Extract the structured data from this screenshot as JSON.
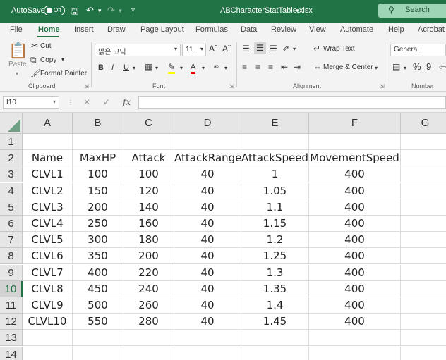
{
  "titlebar": {
    "autosave_label": "AutoSave",
    "autosave_state": "Off",
    "filename": "ABCharacterStatTable.xlsx",
    "search_placeholder": "Search",
    "accent_color": "#217346"
  },
  "tabs": [
    "File",
    "Home",
    "Insert",
    "Draw",
    "Page Layout",
    "Formulas",
    "Data",
    "Review",
    "View",
    "Automate",
    "Help",
    "Acrobat"
  ],
  "active_tab": "Home",
  "ribbon": {
    "clipboard": {
      "paste": "Paste",
      "cut": "Cut",
      "copy": "Copy",
      "format_painter": "Format Painter",
      "label": "Clipboard"
    },
    "font": {
      "name": "맑은 고딕",
      "size": "11",
      "label": "Font"
    },
    "alignment": {
      "wrap_text": "Wrap Text",
      "merge_center": "Merge & Center",
      "label": "Alignment"
    },
    "number": {
      "format": "General",
      "label": "Number"
    }
  },
  "formula_bar": {
    "name_box": "I10",
    "fx": "fx",
    "content": ""
  },
  "grid": {
    "columns": [
      "A",
      "B",
      "C",
      "D",
      "E",
      "F",
      "G"
    ],
    "row_numbers": [
      "1",
      "2",
      "3",
      "4",
      "5",
      "6",
      "7",
      "8",
      "9",
      "10",
      "11",
      "12",
      "13",
      "14"
    ],
    "active_row": "10",
    "rows": [
      [
        "",
        "",
        "",
        "",
        "",
        "",
        ""
      ],
      [
        "Name",
        "MaxHP",
        "Attack",
        "AttackRange",
        "AttackSpeed",
        "MovementSpeed",
        ""
      ],
      [
        "CLVL1",
        "100",
        "100",
        "40",
        "1",
        "400",
        ""
      ],
      [
        "CLVL2",
        "150",
        "120",
        "40",
        "1.05",
        "400",
        ""
      ],
      [
        "CLVL3",
        "200",
        "140",
        "40",
        "1.1",
        "400",
        ""
      ],
      [
        "CLVL4",
        "250",
        "160",
        "40",
        "1.15",
        "400",
        ""
      ],
      [
        "CLVL5",
        "300",
        "180",
        "40",
        "1.2",
        "400",
        ""
      ],
      [
        "CLVL6",
        "350",
        "200",
        "40",
        "1.25",
        "400",
        ""
      ],
      [
        "CLVL7",
        "400",
        "220",
        "40",
        "1.3",
        "400",
        ""
      ],
      [
        "CLVL8",
        "450",
        "240",
        "40",
        "1.35",
        "400",
        ""
      ],
      [
        "CLVL9",
        "500",
        "260",
        "40",
        "1.4",
        "400",
        ""
      ],
      [
        "CLVL10",
        "550",
        "280",
        "40",
        "1.45",
        "400",
        ""
      ],
      [
        "",
        "",
        "",
        "",
        "",
        "",
        ""
      ],
      [
        "",
        "",
        "",
        "",
        "",
        "",
        ""
      ]
    ]
  }
}
